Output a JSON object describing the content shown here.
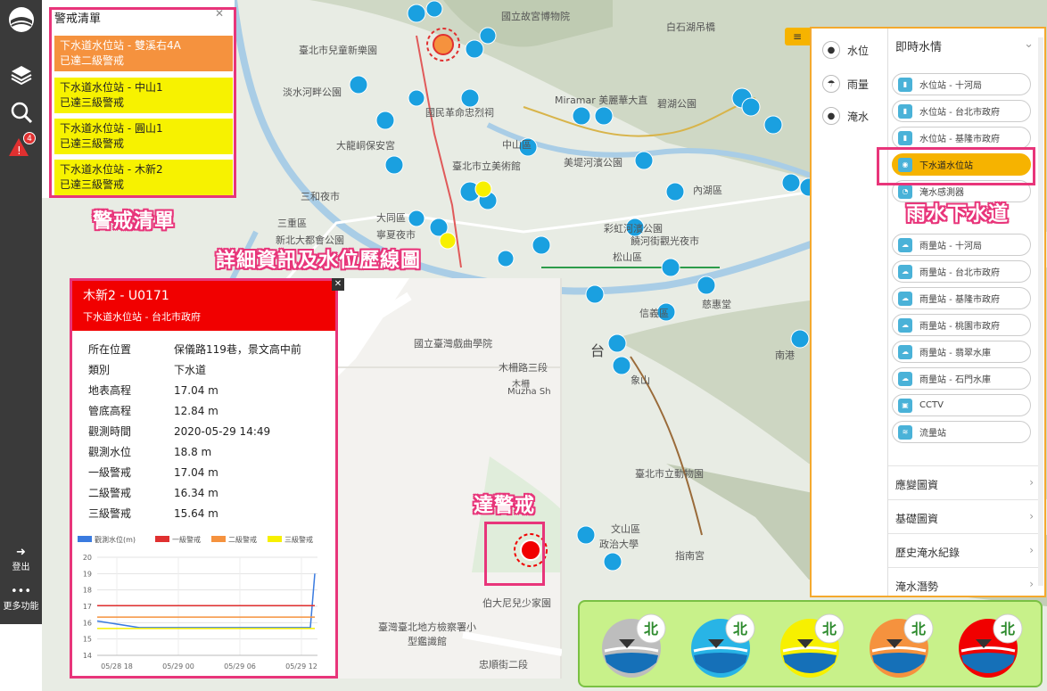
{
  "alert_list": {
    "title": "警戒清單",
    "items": [
      {
        "name": "下水道水位站 - 雙溪右4A",
        "status": "已達二級警戒",
        "level": "orange"
      },
      {
        "name": "下水道水位站 - 中山1",
        "status": "已達三級警戒",
        "level": "yellow"
      },
      {
        "name": "下水道水位站 - 圓山1",
        "status": "已達三級警戒",
        "level": "yellow"
      },
      {
        "name": "下水道水位站 - 木新2",
        "status": "已達三級警戒",
        "level": "yellow"
      }
    ]
  },
  "leftbar": {
    "alert_count": "4",
    "logout": "登出",
    "more": "更多功能"
  },
  "callouts": {
    "alert_list": "警戒清單",
    "detail": "詳細資訊及水位歷線圖",
    "reached_alert": "達警戒",
    "storm_sewer": "雨水下水道"
  },
  "detail": {
    "title": "木新2 - U0171",
    "subtitle": "下水道水位站 - 台北市政府",
    "rows": [
      {
        "k": "所在位置",
        "v": "保儀路119巷，景文高中前"
      },
      {
        "k": "類別",
        "v": "下水道"
      },
      {
        "k": "地表高程",
        "v": "17.04 m"
      },
      {
        "k": "管底高程",
        "v": "12.84 m"
      },
      {
        "k": "觀測時間",
        "v": "2020-05-29 14:49"
      },
      {
        "k": "觀測水位",
        "v": "18.8 m"
      },
      {
        "k": "一級警戒",
        "v": "17.04 m"
      },
      {
        "k": "二級警戒",
        "v": "16.34 m"
      },
      {
        "k": "三級警戒",
        "v": "15.64 m"
      }
    ]
  },
  "chart_data": {
    "type": "line",
    "x": [
      "05/28 18",
      "05/29 00",
      "05/29 06",
      "05/29 12"
    ],
    "ylim": [
      14,
      20
    ],
    "yticks": [
      14,
      15,
      16,
      17,
      18,
      19,
      20
    ],
    "series": [
      {
        "name": "觀測水位(m)",
        "color": "#3a7be0",
        "values": [
          16.1,
          15.7,
          15.7,
          15.7,
          15.7,
          15.7,
          19.0
        ]
      },
      {
        "name": "一級警戒",
        "color": "#e03030",
        "values": [
          17.04,
          17.04
        ]
      },
      {
        "name": "二級警戒",
        "color": "#f5923e",
        "values": [
          16.34,
          16.34
        ]
      },
      {
        "name": "三級警戒",
        "color": "#f7f000",
        "values": [
          15.64,
          15.64
        ]
      }
    ]
  },
  "right_panel": {
    "left_items": [
      {
        "label": "水位",
        "icon": "water-drop-icon"
      },
      {
        "label": "雨量",
        "icon": "umbrella-icon"
      },
      {
        "label": "淹水",
        "icon": "flood-icon"
      }
    ],
    "section_title": "即時水情",
    "buttons": [
      {
        "label": "水位站 - 十河局"
      },
      {
        "label": "水位站 - 台北市政府"
      },
      {
        "label": "水位站 - 基隆市政府"
      },
      {
        "label": "下水道水位站",
        "active": true
      },
      {
        "label": "淹水感測器"
      },
      {
        "label": "雨量站 - 十河局"
      },
      {
        "label": "雨量站 - 台北市政府"
      },
      {
        "label": "雨量站 - 基隆市政府"
      },
      {
        "label": "雨量站 - 桃園市政府"
      },
      {
        "label": "雨量站 - 翡翠水庫"
      },
      {
        "label": "雨量站 - 石門水庫"
      },
      {
        "label": "CCTV"
      },
      {
        "label": "流量站"
      }
    ],
    "sections": [
      "應變圖資",
      "基礎圖資",
      "歷史淹水紀錄",
      "淹水潛勢"
    ]
  },
  "map_labels": {
    "a": "國立故宮博物院",
    "b": "臺北市兒童新樂園",
    "c": "淡水河畔公園",
    "d": "三和夜市",
    "e": "三重區",
    "f": "新北大都會公園",
    "g": "大同區",
    "h": "臺北市立美術館",
    "i": "中山區",
    "j": "美堤河濱公園",
    "k": "內湖區",
    "l": "松山區",
    "m": "饒河街觀光夜市",
    "n": "彩虹河濱公園",
    "o": "信義區",
    "p": "南港",
    "q": "臺北市立動物園",
    "r": "文山區",
    "s": "指南宮",
    "t": "政治大學",
    "u": "白石湖吊橋",
    "v": "碧湖公園",
    "w": "國民革命忠烈祠",
    "x": "大龍峒保安宮",
    "y": "寧夏夜市",
    "z": "國立臺灣戲曲學院",
    "aa": "木柵路三段",
    "ab": "伯大尼兒少家園",
    "ac": "臺灣臺北地方檢察署小型鑑識館",
    "ad": "忠順街二段",
    "ae": "木柵",
    "af": "Muzha Sh",
    "ag": "象山",
    "ah": "慈惠堂",
    "ai": "台",
    "aj": "Miramar 美麗華大直"
  },
  "legend": {
    "station_label": "北",
    "colors": [
      "#bdbdbd",
      "#28b4e6",
      "#f7f000",
      "#f5923e",
      "#f10000"
    ]
  }
}
